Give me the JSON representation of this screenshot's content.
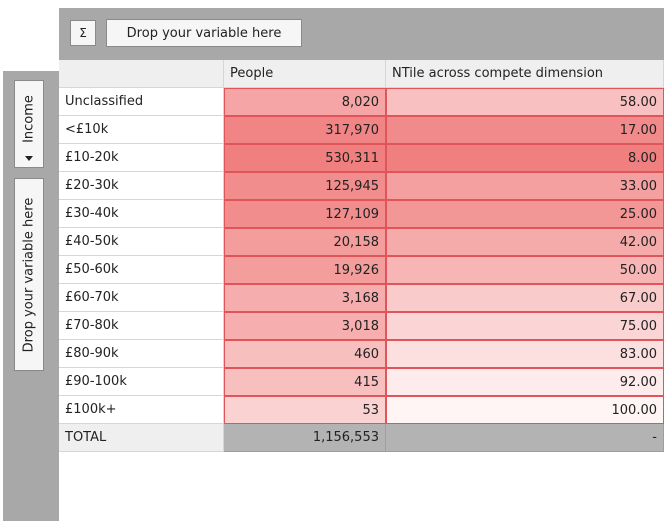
{
  "toolbar": {
    "sigma": "Σ",
    "drop_columns": "Drop your variable here"
  },
  "row_controls": {
    "income_label": "Income",
    "drop_rows": "Drop your variable here"
  },
  "table": {
    "headers": [
      "",
      "People",
      "NTile across compete dimension"
    ],
    "rows": [
      {
        "label": "Unclassified",
        "people": "8,020",
        "ntile": "58.00"
      },
      {
        "label": "<£10k",
        "people": "317,970",
        "ntile": "17.00"
      },
      {
        "label": "£10-20k",
        "people": "530,311",
        "ntile": "8.00"
      },
      {
        "label": "£20-30k",
        "people": "125,945",
        "ntile": "33.00"
      },
      {
        "label": "£30-40k",
        "people": "127,109",
        "ntile": "25.00"
      },
      {
        "label": "£40-50k",
        "people": "20,158",
        "ntile": "42.00"
      },
      {
        "label": "£50-60k",
        "people": "19,926",
        "ntile": "50.00"
      },
      {
        "label": "£60-70k",
        "people": "3,168",
        "ntile": "67.00"
      },
      {
        "label": "£70-80k",
        "people": "3,018",
        "ntile": "75.00"
      },
      {
        "label": "£80-90k",
        "people": "460",
        "ntile": "83.00"
      },
      {
        "label": "£90-100k",
        "people": "415",
        "ntile": "92.00"
      },
      {
        "label": "£100k+",
        "people": "53",
        "ntile": "100.00"
      }
    ],
    "total": {
      "label": "TOTAL",
      "people": "1,156,553",
      "ntile": "-"
    }
  },
  "colors": {
    "heat_low": "#fff5f5",
    "heat_high": "#f08080",
    "cell_border": "#e0555a",
    "zone_bg": "#a8a8a8"
  }
}
